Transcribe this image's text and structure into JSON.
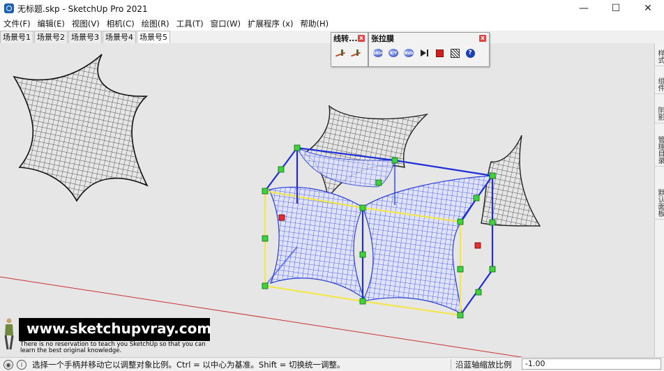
{
  "window": {
    "title": "无标题.skp - SketchUp Pro 2021",
    "controls": {
      "minimize": "—",
      "maximize": "☐",
      "close": "✕"
    }
  },
  "menu": [
    "文件(F)",
    "编辑(E)",
    "视图(V)",
    "相机(C)",
    "绘图(R)",
    "工具(T)",
    "窗口(W)",
    "扩展程序 (x)",
    "帮助(H)"
  ],
  "scene_tabs": [
    {
      "label": "场景号1",
      "active": false
    },
    {
      "label": "场景号2",
      "active": false
    },
    {
      "label": "场景号3",
      "active": false
    },
    {
      "label": "场景号4",
      "active": false
    },
    {
      "label": "场景号5",
      "active": true
    }
  ],
  "toolbars": {
    "line_convert": {
      "title": "线转...",
      "close": "x",
      "icons": [
        "line-to-face-icon",
        "line-to-face-alt-icon"
      ]
    },
    "tension": {
      "title": "张拉膜",
      "close": "x",
      "icons": [
        {
          "name": "skin-icon",
          "label": "Skin"
        },
        {
          "name": "xy-icon",
          "label": "X/Y"
        },
        {
          "name": "bub-icon",
          "label": "Bub"
        },
        {
          "name": "play-icon",
          "label": ""
        },
        {
          "name": "stop-icon",
          "label": ""
        },
        {
          "name": "grid-icon",
          "label": ""
        },
        {
          "name": "help-icon",
          "label": "?"
        }
      ]
    }
  },
  "tray_tabs": [
    "样式",
    "组件",
    "阴影",
    "管理目录",
    "默认面板"
  ],
  "watermark": {
    "url": "www.sketchupvray.com",
    "text": "There is no reservation to teach you SketchUp so that you can learn the best original knowledge."
  },
  "status": {
    "message": "选择一个手柄并移动它以调整对象比例。Ctrl = 以中心为基准。Shift = 切换统一调整。",
    "info_icon": "i",
    "measure_label": "沿蓝轴缩放比例",
    "measure_value": "-1.00"
  },
  "colors": {
    "viewport_bg": "#e6e6e6",
    "bbox_yellow": "#f2e64a",
    "bbox_blue": "#1d2fd6",
    "grip_green": "#3fd23f",
    "grip_red": "#e03030",
    "axis_red": "#c83232",
    "selected_mesh": "#2b3fd8"
  }
}
